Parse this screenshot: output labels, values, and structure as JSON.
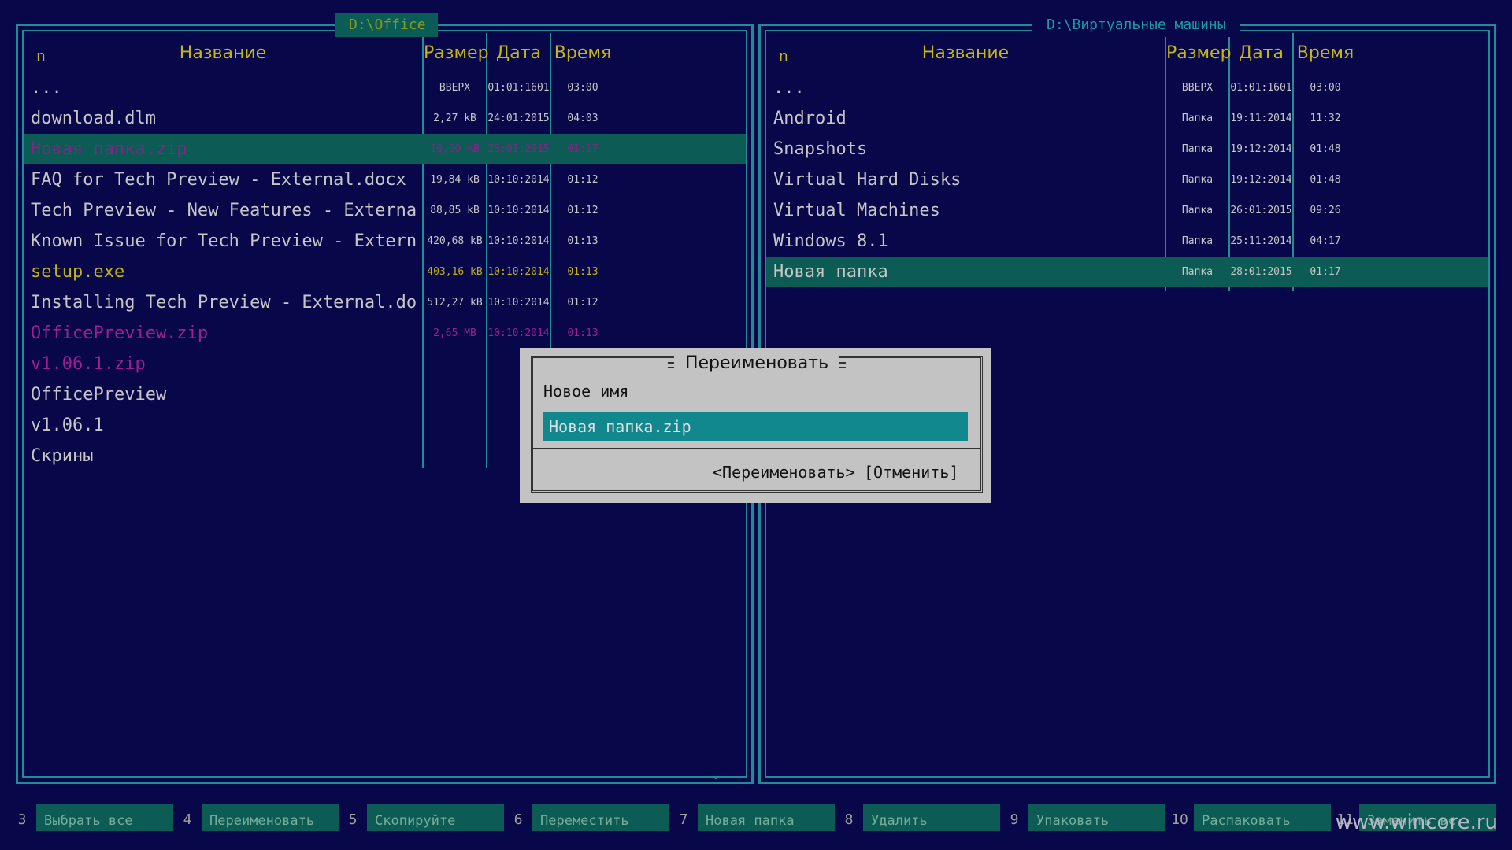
{
  "left_panel": {
    "path": "D:\\Office",
    "headers": {
      "n": "n",
      "name": "Название",
      "size": "Размер",
      "date": "Дата",
      "time": "Время"
    },
    "rows": [
      {
        "name": "...",
        "size": "ВВЕРХ",
        "date": "01:01:1601",
        "time": "03:00",
        "color": "white"
      },
      {
        "name": "download.dlm",
        "size": "2,27 kB",
        "date": "24:01:2015",
        "time": "04:03",
        "color": "white"
      },
      {
        "name": "Новая папка.zip",
        "size": "10,00 kB",
        "date": "28:01:2015",
        "time": "01:17",
        "color": "sel",
        "selected": true
      },
      {
        "name": "FAQ for Tech Preview - External.docx",
        "size": "19,84 kB",
        "date": "10:10:2014",
        "time": "01:12",
        "color": "white"
      },
      {
        "name": "Tech Preview - New Features - External.docx",
        "size": "88,85 kB",
        "date": "10:10:2014",
        "time": "01:12",
        "color": "white"
      },
      {
        "name": "Known Issue for Tech Preview - External.docx",
        "size": "420,68 kB",
        "date": "10:10:2014",
        "time": "01:13",
        "color": "white"
      },
      {
        "name": "setup.exe",
        "size": "403,16 kB",
        "date": "10:10:2014",
        "time": "01:13",
        "color": "yellow"
      },
      {
        "name": "Installing Tech Preview - External.docx",
        "size": "512,27 kB",
        "date": "10:10:2014",
        "time": "01:12",
        "color": "white"
      },
      {
        "name": "OfficePreview.zip",
        "size": "2,65 MB",
        "date": "10:10:2014",
        "time": "01:13",
        "color": "magenta"
      },
      {
        "name": "v1.06.1.zip",
        "size": "",
        "date": "",
        "time": "",
        "color": "magenta"
      },
      {
        "name": "OfficePreview",
        "size": "",
        "date": "",
        "time": "",
        "color": "white"
      },
      {
        "name": "v1.06.1",
        "size": "",
        "date": "",
        "time": "",
        "color": "white"
      },
      {
        "name": "Скрины",
        "size": "",
        "date": "",
        "time": "",
        "color": "white"
      }
    ]
  },
  "right_panel": {
    "path": "D:\\Виртуальные машины",
    "headers": {
      "n": "n",
      "name": "Название",
      "size": "Размер",
      "date": "Дата",
      "time": "Время"
    },
    "rows": [
      {
        "name": "...",
        "size": "ВВЕРХ",
        "date": "01:01:1601",
        "time": "03:00",
        "color": "white"
      },
      {
        "name": "Android",
        "size": "Папка",
        "date": "19:11:2014",
        "time": "11:32",
        "color": "white"
      },
      {
        "name": "Snapshots",
        "size": "Папка",
        "date": "19:12:2014",
        "time": "01:48",
        "color": "white"
      },
      {
        "name": "Virtual Hard Disks",
        "size": "Папка",
        "date": "19:12:2014",
        "time": "01:48",
        "color": "white"
      },
      {
        "name": "Virtual Machines",
        "size": "Папка",
        "date": "26:01:2015",
        "time": "09:26",
        "color": "white"
      },
      {
        "name": "Windows 8.1",
        "size": "Папка",
        "date": "25:11:2014",
        "time": "04:17",
        "color": "white"
      },
      {
        "name": "Новая папка",
        "size": "Папка",
        "date": "28:01:2015",
        "time": "01:17",
        "color": "selw",
        "selected": true
      }
    ]
  },
  "dialog": {
    "title": "Переименовать",
    "label": "Новое имя",
    "input_value": "Новая папка.zip",
    "ok_label": "<Переименовать>",
    "cancel_label": "[Отменить]"
  },
  "function_keys": [
    {
      "num": "3",
      "label": "Выбрать все"
    },
    {
      "num": "4",
      "label": "Переименовать"
    },
    {
      "num": "5",
      "label": "Скопируйте"
    },
    {
      "num": "6",
      "label": "Переместить"
    },
    {
      "num": "7",
      "label": "Новая папка"
    },
    {
      "num": "8",
      "label": "Удалить"
    },
    {
      "num": "9",
      "label": "Упаковать"
    },
    {
      "num": "10",
      "label": "Распаковать"
    },
    {
      "num": "11",
      "label": "Заменить вс"
    }
  ],
  "watermark": "www.wincore.ru",
  "colors": {
    "background": "#07074a",
    "border": "#1f8c96",
    "header": "#c4b51c",
    "selection": "#0c5c55",
    "input": "#11888e",
    "dialog": "#c3c3c3"
  }
}
